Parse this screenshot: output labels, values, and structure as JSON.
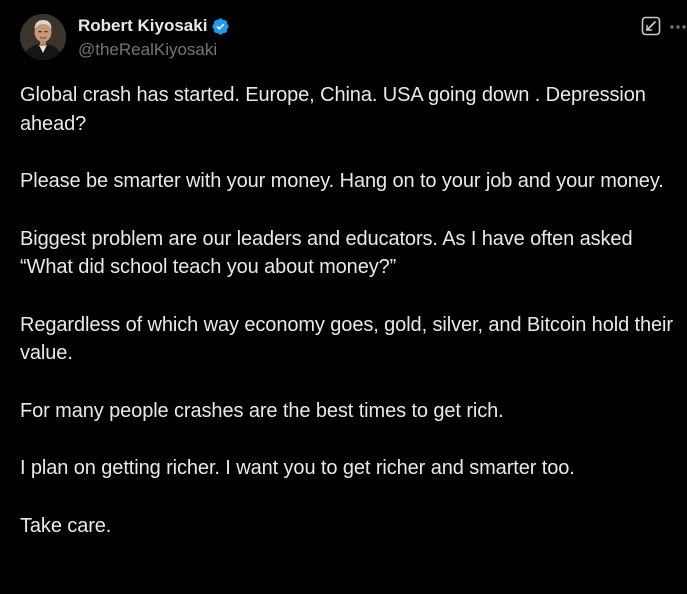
{
  "author": {
    "display_name": "Robert Kiyosaki",
    "handle": "@theRealKiyosaki",
    "verified": true,
    "verified_color": "#1d9bf0"
  },
  "icons": {
    "verified": "verified-badge-icon",
    "grok": "grok-icon",
    "more": "more-options-icon"
  },
  "colors": {
    "background": "#000000",
    "text_primary": "#e7e9ea",
    "text_secondary": "#71767b"
  },
  "post": {
    "paragraphs": [
      "Global crash has started.  Europe, China. USA going down .  Depression ahead?",
      "Please be smarter with your money.  Hang on to your job and your money.",
      "Biggest problem are our leaders and educators.  As I have often asked “What did school teach you about money?”",
      "Regardless of which way economy goes, gold, silver, and Bitcoin hold their value.",
      "For many people crashes are the best times to get rich.",
      "I plan on getting richer.  I want you to get richer and smarter too.",
      "Take care."
    ]
  }
}
